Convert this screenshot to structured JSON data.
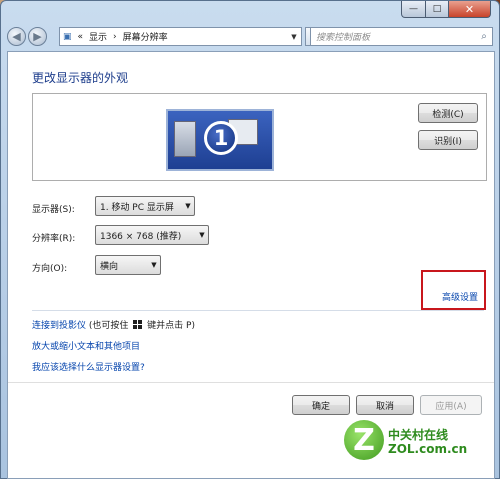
{
  "window": {
    "controls": {
      "minimize": "—",
      "maximize": "□",
      "close": "✕"
    }
  },
  "nav": {
    "back_icon": "back-arrow",
    "forward_icon": "forward-arrow",
    "address": {
      "prefix": "«",
      "crumb1": "显示",
      "sep": "›",
      "crumb2": "屏幕分辨率"
    },
    "search_placeholder": "搜索控制面板"
  },
  "main": {
    "heading": "更改显示器的外观",
    "monitor_number": "1",
    "detect_button": "检测(C)",
    "identify_button": "识别(I)",
    "fields": {
      "display": {
        "label": "显示器(S):",
        "value": "1. 移动 PC 显示屏"
      },
      "resolution": {
        "label": "分辨率(R):",
        "value": "1366 × 768 (推荐)"
      },
      "orientation": {
        "label": "方向(O):",
        "value": "横向"
      }
    },
    "advanced_link": "高级设置",
    "links": {
      "projector": "连接到投影仪",
      "projector_hint_pre": "(也可按住",
      "projector_hint_post": "键并点击 P)",
      "zoom_text": "放大或缩小文本和其他项目",
      "which_settings": "我应该选择什么显示器设置?"
    },
    "buttons": {
      "ok": "确定",
      "cancel": "取消",
      "apply": "应用(A)"
    }
  },
  "watermark": {
    "mark": "Z",
    "name_cn": "中关村在线",
    "name_en": "ZOL.com.cn"
  },
  "colors": {
    "link": "#0645ad",
    "highlight_box": "#c8161c",
    "heading": "#1e3e8c"
  }
}
